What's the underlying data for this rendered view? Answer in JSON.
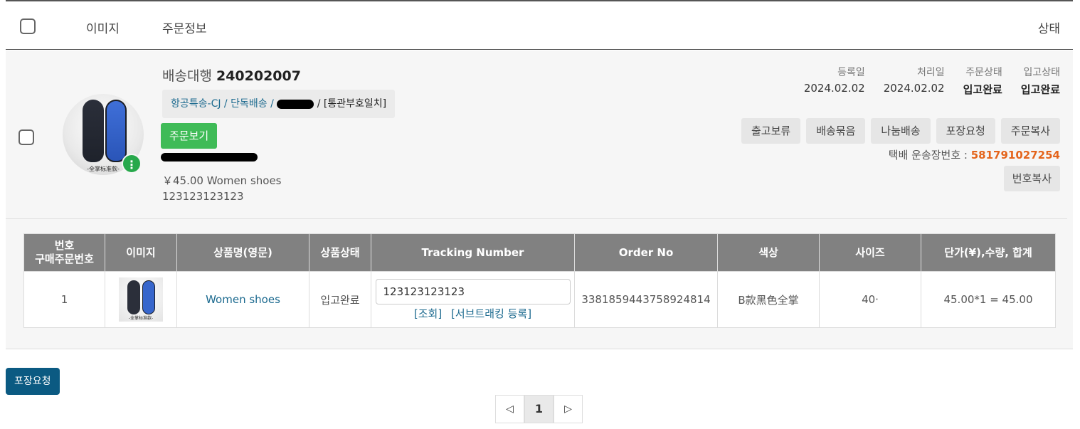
{
  "header": {
    "image_label": "이미지",
    "info_label": "주문정보",
    "status_label": "상태"
  },
  "order": {
    "type_label": "배송대행",
    "order_number": "240202007",
    "route_part1": "항공특송-CJ / 단독배송 /",
    "route_part2": " / [통관부호일치]",
    "view_button": "주문보기",
    "thumb_caption": "-全掌标准款-",
    "more_icon": "⋮",
    "price_line": "￥45.00  Women shoes",
    "tracking_line": "123123123123",
    "dates": {
      "registered_label": "등록일",
      "registered_value": "2024.02.02",
      "processed_label": "처리일",
      "processed_value": "2024.02.02",
      "order_status_label": "주문상태",
      "order_status_value": "입고완료",
      "stock_status_label": "입고상태",
      "stock_status_value": "입고완료"
    },
    "actions": [
      "출고보류",
      "배송묶음",
      "나눔배송",
      "포장요청",
      "주문복사"
    ],
    "waybill_label": "택배 운송장번호 : ",
    "waybill_number": "581791027254",
    "copy_number_button": "번호복사"
  },
  "items_table": {
    "headers": {
      "no_line1": "번호",
      "no_line2": "구매주문번호",
      "image": "이미지",
      "name": "상품명(영문)",
      "status": "상품상태",
      "tracking": "Tracking Number",
      "order_no": "Order No",
      "color": "색상",
      "size": "사이즈",
      "price": "단가(¥),수량, 합계"
    },
    "rows": [
      {
        "no": "1",
        "name": "Women shoes",
        "status": "입고완료",
        "tracking": "123123123123",
        "lookup_link": "[조회]",
        "subtracking_link": "[서브트래킹 등록]",
        "order_no": "3381859443758924814",
        "color": "B款黑色全掌",
        "size": "40·",
        "price_calc": "45.00*1 = 45.00",
        "thumb_caption": "-全掌标准款-"
      }
    ]
  },
  "footer": {
    "pack_request_button": "포장요청",
    "pager": {
      "prev": "◁",
      "current": "1",
      "next": "▷"
    }
  },
  "colors": {
    "accent_green": "#3fbb57",
    "link_blue": "#1c6a8f",
    "waybill_orange": "#e4641b",
    "primary_button": "#0b5a82",
    "table_header": "#818181"
  }
}
